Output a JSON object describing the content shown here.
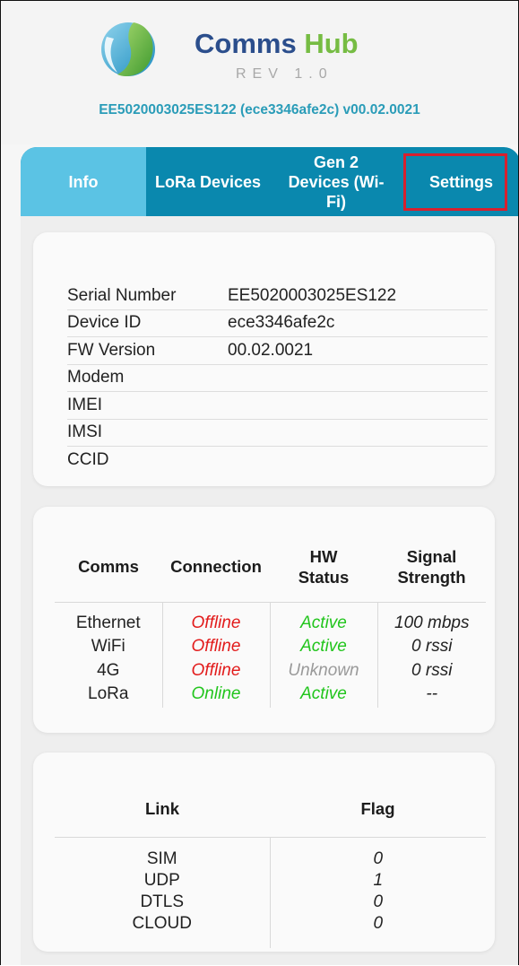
{
  "header": {
    "brand_name_1": "Comms",
    "brand_name_2": "Hub",
    "brand_rev": "REV 1.0",
    "device_line": "EE5020003025ES122 (ece3346afe2c) v00.02.0021",
    "colors": {
      "brand_blue": "#2b4e8c",
      "brand_green": "#76bc43",
      "device_line": "#2a9cb8"
    }
  },
  "tabs": [
    {
      "label": "Info",
      "active": true
    },
    {
      "label": "LoRa Devices",
      "active": false
    },
    {
      "label": "Gen 2\nDevices (Wi-\nFi)",
      "active": false
    },
    {
      "label": "Settings",
      "active": false,
      "highlighted": true
    }
  ],
  "info": {
    "rows": [
      {
        "key": "Serial Number",
        "value": "EE5020003025ES122"
      },
      {
        "key": "Device ID",
        "value": "ece3346afe2c"
      },
      {
        "key": "FW Version",
        "value": "00.02.0021"
      },
      {
        "key": "Modem",
        "value": ""
      },
      {
        "key": "IMEI",
        "value": ""
      },
      {
        "key": "IMSI",
        "value": ""
      },
      {
        "key": "CCID",
        "value": ""
      }
    ]
  },
  "comms": {
    "headers": [
      "Comms",
      "Connection",
      "HW\nStatus",
      "Signal\nStrength"
    ],
    "rows": [
      {
        "comms": "Ethernet",
        "connection": "Offline",
        "hw": "Active",
        "signal": "100 mbps"
      },
      {
        "comms": "WiFi",
        "connection": "Offline",
        "hw": "Active",
        "signal": "0 rssi"
      },
      {
        "comms": "4G",
        "connection": "Offline",
        "hw": "Unknown",
        "signal": "0 rssi"
      },
      {
        "comms": "LoRa",
        "connection": "Online",
        "hw": "Active",
        "signal": "--"
      }
    ],
    "status_colors": {
      "Offline": "#e21b1b",
      "Online": "#22c51d",
      "Active": "#22c51d",
      "Unknown": "#9a9a9a"
    }
  },
  "link": {
    "headers": [
      "Link",
      "Flag"
    ],
    "rows": [
      {
        "link": "SIM",
        "flag": "0"
      },
      {
        "link": "UDP",
        "flag": "1"
      },
      {
        "link": "DTLS",
        "flag": "0"
      },
      {
        "link": "CLOUD",
        "flag": "0"
      }
    ]
  }
}
